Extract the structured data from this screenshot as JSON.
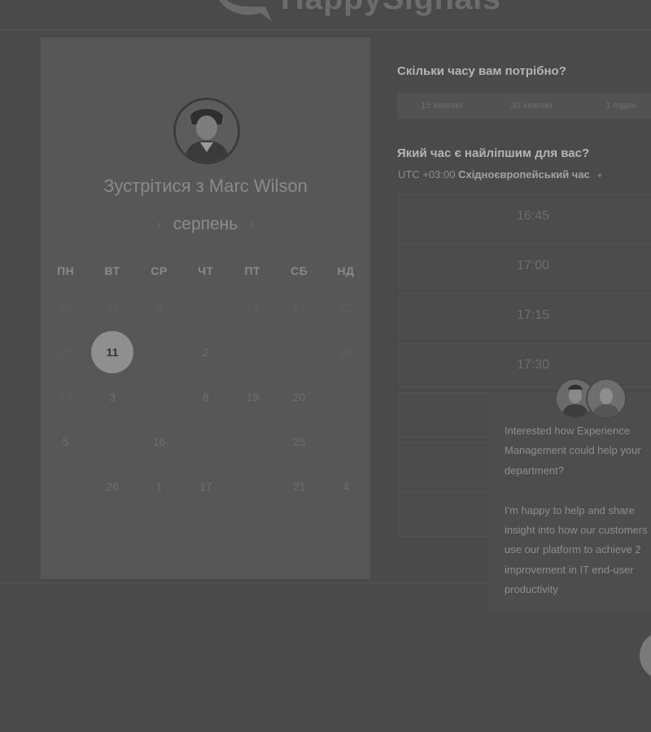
{
  "brand": {
    "name": "HappySignals"
  },
  "calendar": {
    "title": "Зустрітися з Marc Wilson",
    "month": "серпень",
    "prev_icon": "‹",
    "next_icon": "›",
    "weekdays": [
      "ПН",
      "ВТ",
      "СР",
      "ЧТ",
      "ПТ",
      "СБ",
      "НД"
    ],
    "weeks": [
      [
        "30",
        "31",
        "9",
        "",
        "15",
        "14",
        "22"
      ],
      [
        "27",
        "11",
        "",
        "2",
        "",
        "",
        "23"
      ],
      [
        "13",
        "3",
        "",
        "8",
        "19",
        "20",
        ""
      ],
      [
        "5",
        "",
        "16",
        "",
        "",
        "25",
        ""
      ],
      [
        "",
        "26",
        "1",
        "17",
        "",
        "21",
        "4"
      ]
    ],
    "selected_day": "11"
  },
  "booking": {
    "duration_question": "Скільки часу вам потрібно?",
    "durations": [
      "15 хвилин",
      "30 хвилин",
      "1 годин"
    ],
    "time_question": "Який час є найліпшим для вас?",
    "timezone_offset": "UTC +03:00",
    "timezone_name": "Східноєвропейський час",
    "slots": [
      "16:45",
      "17:00",
      "17:15",
      "17:30",
      "",
      "",
      ""
    ]
  },
  "chat": {
    "message": "Interested how Experience\nManagement could help your\ndepartment?\n\nI'm happy to help and share\ninsight into how our customers\nuse our platform to achieve 2\nimprovement in IT end-user\nproductivity"
  },
  "colors": {
    "overlay": "#4a4a4a",
    "panel": "#575757",
    "selected": "#8f8f8f"
  }
}
